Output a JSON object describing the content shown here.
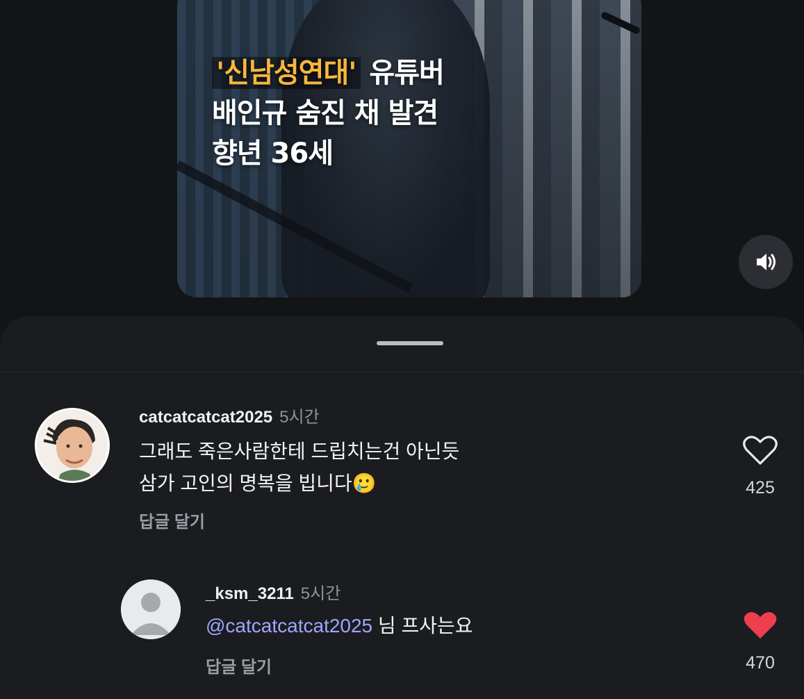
{
  "video": {
    "headline_highlight": "'신남성연대'",
    "headline_line1_rest": " 유튜버",
    "headline_line2": "배인규 숨진 채 발견",
    "headline_line3": "향년 36세"
  },
  "colors": {
    "highlight": "#f6b73c",
    "mention": "#9fa7ff",
    "liked_heart": "#ef3e4f",
    "sheet_bg": "#1b1c1f"
  },
  "comments": [
    {
      "username": "catcatcatcat2025",
      "time": "5시간",
      "line1": "그래도 죽은사람한테  드립치는건 아닌듯",
      "line2": "삼가 고인의 명복을 빕니다",
      "emoji": "🥲",
      "reply_label": "답글 달기",
      "like_count": "425",
      "liked": false
    },
    {
      "username": "_ksm_3211",
      "time": "5시간",
      "mention": "@catcatcatcat2025",
      "text_rest": " 님 프사는요",
      "reply_label": "답글 달기",
      "like_count": "470",
      "liked": true
    }
  ]
}
